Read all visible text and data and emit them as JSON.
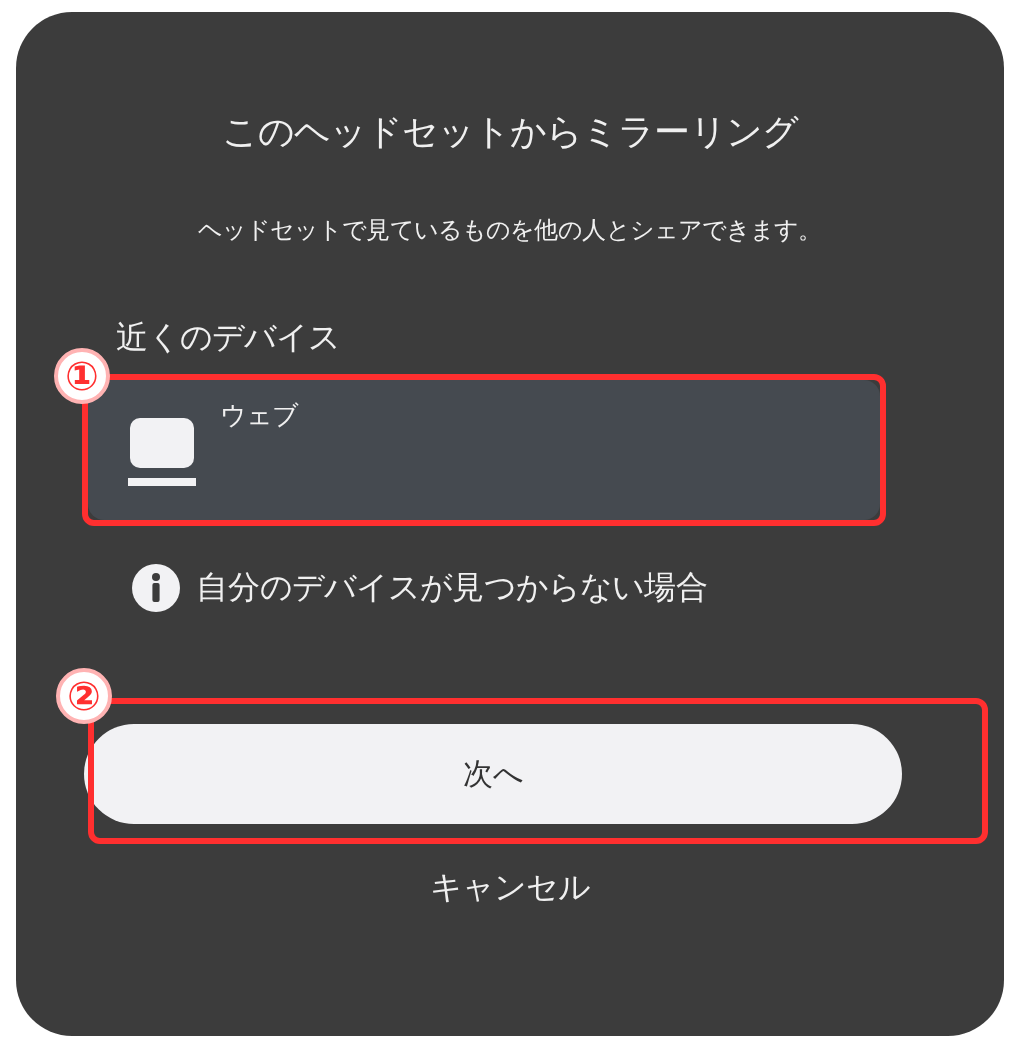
{
  "dialog": {
    "title": "このヘッドセットからミラーリング",
    "subtitle": "ヘッドセットで見ているものを他の人とシェアできます。"
  },
  "nearby": {
    "label": "近くのデバイス",
    "devices": [
      {
        "name": "ウェブ"
      }
    ]
  },
  "help_link": "自分のデバイスが見つからない場合",
  "next_button": "次へ",
  "cancel_button": "キャンセル",
  "annotations": [
    {
      "label": "①"
    },
    {
      "label": "②"
    }
  ]
}
